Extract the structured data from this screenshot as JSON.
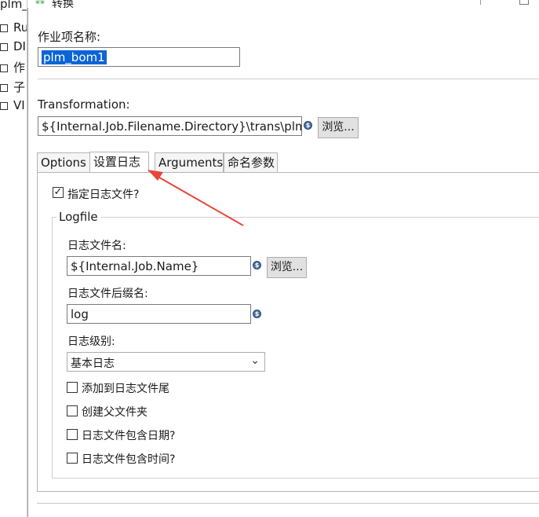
{
  "tree": {
    "top_label": "plm_",
    "items": [
      "Ru",
      "DI",
      "作",
      "子",
      "VI"
    ]
  },
  "dialog": {
    "title": "转换",
    "title_icon": "transformation-icon"
  },
  "job_name": {
    "label": "作业项名称:",
    "value": "plm_bom1"
  },
  "transformation": {
    "label": "Transformation:",
    "value": "${Internal.Job.Filename.Directory}\\trans\\plm_v",
    "browse_label": "浏览..."
  },
  "tabs": [
    {
      "label": "Options",
      "active": false
    },
    {
      "label": "设置日志",
      "active": true
    },
    {
      "label": "Arguments",
      "active": false
    },
    {
      "label": "命名参数",
      "active": false
    }
  ],
  "log_settings": {
    "specify_logfile_label": "指定日志文件?",
    "specify_logfile_checked": true,
    "group_title": "Logfile",
    "logfile_name_label": "日志文件名:",
    "logfile_name_value": "${Internal.Job.Name}",
    "browse_label": "浏览...",
    "extension_label": "日志文件后缀名:",
    "extension_value": "log",
    "level_label": "日志级别:",
    "level_value": "基本日志",
    "options": [
      {
        "label": "添加到日志文件尾",
        "checked": false
      },
      {
        "label": "创建父文件夹",
        "checked": false
      },
      {
        "label": "日志文件包含日期?",
        "checked": false
      },
      {
        "label": "日志文件包含时间?",
        "checked": false
      }
    ]
  },
  "colors": {
    "selection": "#0a64d6",
    "annotation_arrow": "#e8463b",
    "variable_icon": "#4a6f9e"
  }
}
